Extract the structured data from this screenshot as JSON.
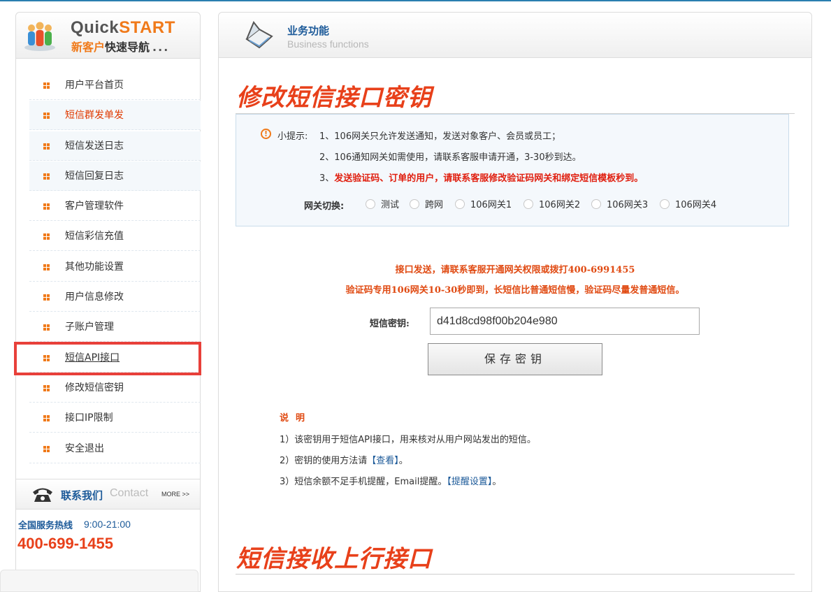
{
  "sidebar": {
    "brand_a": "Quick",
    "brand_b": "START",
    "sub_orange": "新客户",
    "sub_dark": "快速导航",
    "sub_dots": "...",
    "items": [
      {
        "label": "用户平台首页"
      },
      {
        "label": "短信群发单发"
      },
      {
        "label": "短信发送日志"
      },
      {
        "label": "短信回复日志"
      },
      {
        "label": "客户管理软件"
      },
      {
        "label": "短信彩信充值"
      },
      {
        "label": "其他功能设置"
      },
      {
        "label": "用户信息修改"
      },
      {
        "label": "子账户管理"
      },
      {
        "label": "短信API接口"
      },
      {
        "label": "修改短信密钥"
      },
      {
        "label": "接口IP限制"
      },
      {
        "label": "安全退出"
      }
    ],
    "contact_title": "联系我们",
    "contact_en": "Contact",
    "contact_more": "MORE >>",
    "hotline_label": "全国服务热线",
    "hotline_hours": "9:00-21:00",
    "hotline_number": "400-699-1455"
  },
  "header": {
    "title": "业务功能",
    "subtitle": "Business functions"
  },
  "main": {
    "section1_title": "修改短信接口密钥",
    "tip": {
      "label": "小提示:",
      "line1": "1、106网关只允许发送通知，发送对象客户、会员或员工；",
      "line2": "2、106通知网关如需使用，请联系客服申请开通，3-30秒到达。",
      "line3_num": "3、",
      "line3": "发送验证码、订单的用户，请联系客服修改验证码网关和绑定短信模板秒到。"
    },
    "gateway": {
      "label": "网关切换:",
      "options": [
        {
          "label": "测试"
        },
        {
          "label": "跨网"
        },
        {
          "label": "106网关1"
        },
        {
          "label": "106网关2"
        },
        {
          "label": "106网关3"
        },
        {
          "label": "106网关4"
        }
      ]
    },
    "notice1": "接口发送，请联系客服开通网关权限或拨打400-6991455",
    "notice2": "验证码专用106网关10-30秒即到，长短信比普通短信慢，验证码尽量发普通短信。",
    "key_label": "短信密钥:",
    "key_value": "d41d8cd98f00b204e980",
    "save_label": "保存密钥",
    "desc_title": "说明",
    "desc1": "1）该密钥用于短信API接口，用来核对从用户网站发出的短信。",
    "desc2_pre": "2）密钥的使用方法请",
    "desc2_link": "【查看】",
    "desc2_post": "。",
    "desc3_pre": "3）短信余额不足手机提醒，Email提醒。",
    "desc3_link": "【提醒设置】",
    "desc3_post": "。",
    "section2_title": "短信接收上行接口"
  },
  "colors": {
    "accent_orange": "#f07a1a",
    "title_red": "#e8401a",
    "link_blue": "#1c5a99",
    "highlight_box": "#e8403a"
  },
  "icons": [
    "quickstart-people-icon",
    "grid-bullet-icon",
    "phone-icon",
    "book-icon",
    "warning-icon"
  ]
}
